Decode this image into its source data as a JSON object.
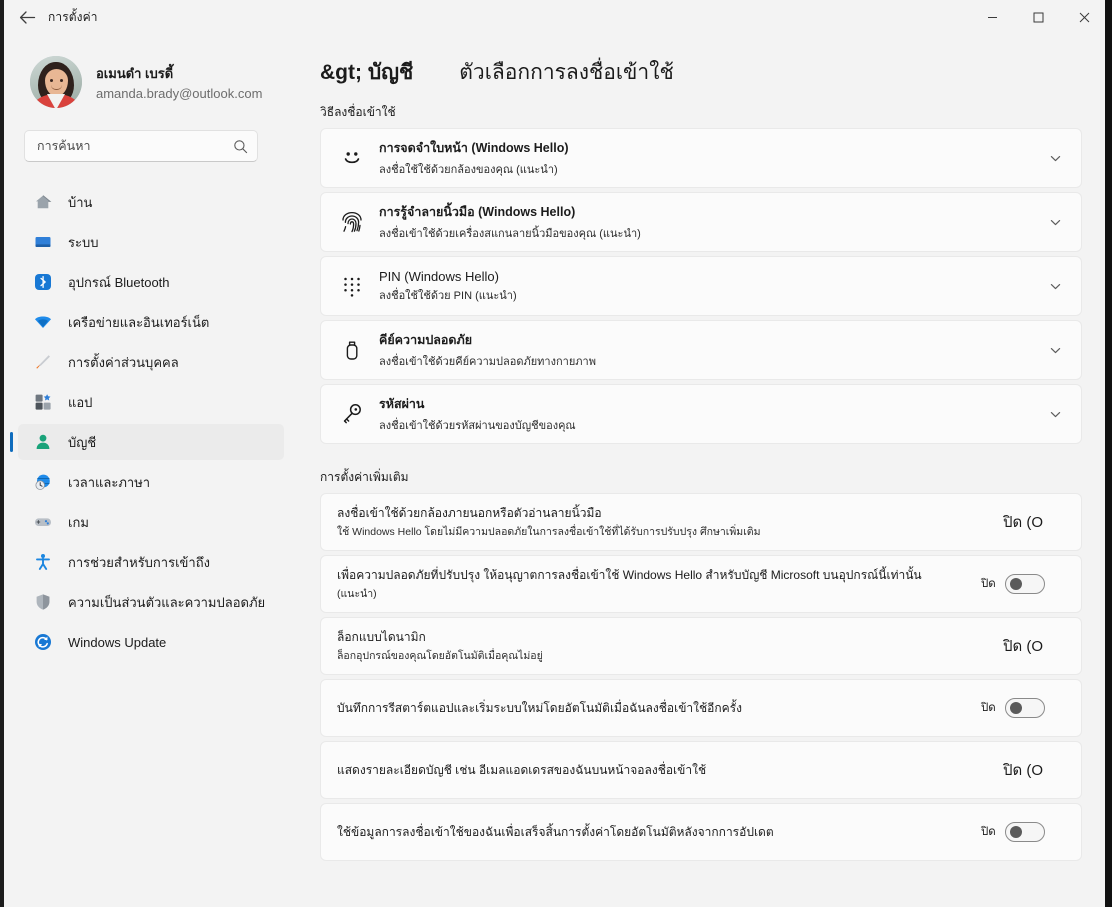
{
  "window": {
    "titlebar_title": "การตั้งค่า",
    "back_icon": "back-arrow-icon",
    "minimize_label": "–",
    "maximize_label": "☐",
    "close_label": "✕"
  },
  "sidebar": {
    "profile": {
      "name": "อเมนดำ เบรดี้",
      "email": "amanda.brady@outlook.com",
      "avatar_icon": "user-avatar-photo"
    },
    "search": {
      "placeholder": "การค้นหา",
      "value": "",
      "icon": "search-icon"
    },
    "items": [
      {
        "label": "บ้าน",
        "icon": "home-icon",
        "selected": false
      },
      {
        "label": "ระบบ",
        "icon": "system-monitor-icon",
        "selected": false
      },
      {
        "label": "อุปกรณ์ Bluetooth",
        "icon": "bluetooth-icon",
        "selected": false
      },
      {
        "label": "เครือข่ายและอินเทอร์เน็ต",
        "icon": "wifi-icon",
        "selected": false
      },
      {
        "label": "การตั้งค่าส่วนบุคคล",
        "icon": "paintbrush-icon",
        "selected": false
      },
      {
        "label": "แอป",
        "icon": "apps-grid-icon",
        "selected": false
      },
      {
        "label": "บัญชี",
        "icon": "account-person-icon",
        "selected": true
      },
      {
        "label": "เวลาและภาษา",
        "icon": "clock-globe-icon",
        "selected": false
      },
      {
        "label": "เกม",
        "icon": "gamepad-icon",
        "selected": false
      },
      {
        "label": "การช่วยสำหรับการเข้าถึง",
        "icon": "accessibility-person-icon",
        "selected": false
      },
      {
        "label": "ความเป็นส่วนตัวและความปลอดภัย",
        "icon": "shield-icon",
        "selected": false
      },
      {
        "label": "Windows Update",
        "icon": "update-refresh-icon",
        "selected": false
      }
    ]
  },
  "main": {
    "breadcrumb": "&gt; บัญชี",
    "page_title": "ตัวเลือกการลงชื่อเข้าใช้",
    "signin_section_label": "วิธีลงชื่อเข้าใช้",
    "signin_methods": [
      {
        "title": "การจดจำใบหน้า  (Windows Hello)",
        "subtitle": "ลงชื่อใช้ใช้ด้วยกล้องของคุณ (แนะนำ)",
        "icon": "face-smiley-icon",
        "chevron": "chevron-down-icon"
      },
      {
        "title": "การรู้จำลายนิ้วมือ  (Windows Hello)",
        "subtitle": "ลงชื่อเข้าใช้ด้วยเครื่องสแกนลายนิ้วมือของคุณ (แนะนำ)",
        "icon": "fingerprint-icon",
        "chevron": "chevron-down-icon"
      },
      {
        "title": "PIN (Windows Hello)",
        "subtitle": "ลงชื่อใช้ใช้ด้วย PIN (แนะนำ)",
        "icon": "pin-keypad-icon",
        "chevron": "chevron-down-icon"
      },
      {
        "title": "คีย์ความปลอดภัย",
        "subtitle": "ลงชื่อเข้าใช้ด้วยคีย์ความปลอดภัยทางกายภาพ",
        "icon": "security-key-icon",
        "chevron": "chevron-down-icon"
      },
      {
        "title": "รหัสผ่าน",
        "subtitle": "ลงชื่อเข้าใช้ด้วยรหัสผ่านของบัญชีของคุณ",
        "icon": "password-key-icon",
        "chevron": "chevron-down-icon"
      }
    ],
    "additional_section_label": "การตั้งค่าเพิ่มเติม",
    "additional_settings": [
      {
        "title": "ลงชื่อเข้าใช้ด้วยกล้องภายนอกหรือตัวอ่านลายนิ้วมือ",
        "subtitle": "ใช้ Windows Hello โดยไม่มีความปลอดภัยในการลงชื่อเข้าใช้ที่ได้รับการปรับปรุง ศึกษาเพิ่มเติม",
        "toggle_label": "ปิด (O",
        "toggle_state": "off",
        "label_clipped": true,
        "show_switch": false
      },
      {
        "title": "เพื่อความปลอดภัยที่ปรับปรุง  ให้อนุญาตการลงชื่อเข้าใช้ Windows  Hello สำหรับบัญชี Microsoft บนอุปกรณ์นี้เท่านั้น",
        "subtitle": "(แนะนำ)",
        "toggle_label": "ปิด",
        "toggle_state": "off",
        "label_clipped": false,
        "show_switch": true
      },
      {
        "title": "ล็อกแบบไดนามิก",
        "subtitle": "ล็อกอุปกรณ์ของคุณโดยอัตโนมัติเมื่อคุณไม่อยู่",
        "toggle_label": "ปิด (O",
        "toggle_state": "off",
        "label_clipped": true,
        "show_switch": false
      },
      {
        "title": "บันทึกการรีสตาร์ตแอปและเริ่มระบบใหม่โดยอัตโนมัติเมื่อฉันลงชื่อเข้าใช้อีกครั้ง",
        "subtitle": "",
        "toggle_label": "ปิด",
        "toggle_state": "off",
        "label_clipped": false,
        "show_switch": true
      },
      {
        "title": "แสดงรายละเอียดบัญชี เช่น อีเมลแอดเดรสของฉันบนหน้าจอลงชื่อเข้าใช้",
        "subtitle": "",
        "toggle_label": "ปิด (O",
        "toggle_state": "off",
        "label_clipped": true,
        "show_switch": false
      },
      {
        "title": "ใช้ข้อมูลการลงชื่อเข้าใช้ของฉันเพื่อเสร็จสิ้นการตั้งค่าโดยอัตโนมัติหลังจากการอัปเดต",
        "subtitle": "",
        "toggle_label": "ปิด",
        "toggle_state": "off",
        "label_clipped": false,
        "show_switch": true
      }
    ]
  },
  "colors": {
    "accent": "#0f6cbd",
    "window_bg": "#f3f3f3",
    "card_bg": "#fbfbfb",
    "card_border": "#e9e9e9",
    "text": "#1b1b1b",
    "muted_text": "#6d6d6d",
    "close_hover": "#c42b1c"
  }
}
